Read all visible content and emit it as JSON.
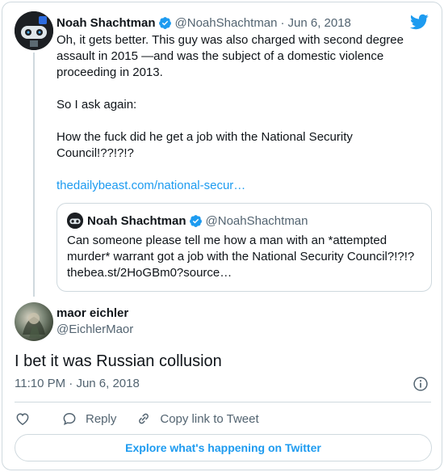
{
  "colors": {
    "accent": "#1d9bf0",
    "text": "#0f1419",
    "muted": "#536471",
    "border": "#cfd9de"
  },
  "icons": {
    "verified": "verified-badge-icon",
    "brand": "twitter-bird-icon",
    "like": "heart-icon",
    "reply": "speech-bubble-icon",
    "copy": "link-icon",
    "info": "info-icon"
  },
  "parent_tweet": {
    "author_name": "Noah Shachtman",
    "author_handle": "@NoahShachtman",
    "separator": "·",
    "date": "Jun 6, 2018",
    "paragraphs": [
      "Oh, it gets better. This guy was also charged with second degree assault in 2015 —and was the subject of a domestic violence proceeding in 2013.",
      "So I ask again:",
      "How the fuck did he get a job with the National Security Council!??!?!?"
    ],
    "link": "thedailybeast.com/national-secur…"
  },
  "quoted_tweet": {
    "author_name": "Noah Shachtman",
    "author_handle": "@NoahShachtman",
    "text": "Can someone please tell me how a man with an *attempted murder* warrant got a job with the National Security Council?!?!? thebea.st/2HoGBm0?source…"
  },
  "reply_tweet": {
    "author_name": "maor eichler",
    "author_handle": "@EichlerMaor",
    "text": "I bet it was Russian collusion",
    "time": "11:10 PM",
    "separator": "·",
    "date": "Jun 6, 2018"
  },
  "actions": {
    "reply_label": "Reply",
    "copy_label": "Copy link to Tweet"
  },
  "explore_label": "Explore what's happening on Twitter"
}
